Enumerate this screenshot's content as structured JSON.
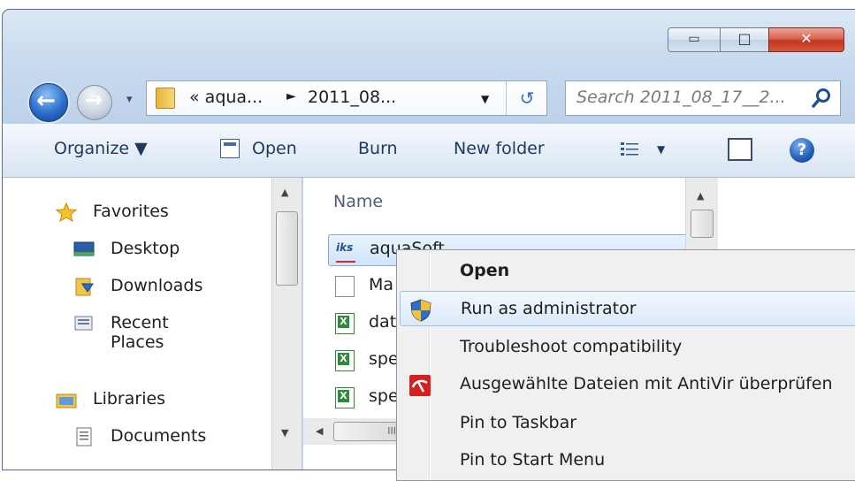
{
  "window": {
    "caption": {
      "minimize_glyph": "▭",
      "maximize_glyph": "□",
      "close_glyph": "✕"
    }
  },
  "nav": {
    "back_glyph": "←",
    "forward_glyph": "→",
    "recent_glyph": "▾"
  },
  "address": {
    "crumb_prefix": "«",
    "crumb_1": "aqua...",
    "separator": "►",
    "crumb_2": "2011_08...",
    "dropdown_glyph": "▼",
    "refresh_glyph": "↺"
  },
  "search": {
    "placeholder": "Search 2011_08_17__2..."
  },
  "toolbar": {
    "organize": "Organize ▼",
    "open": "Open",
    "burn": "Burn",
    "new_folder": "New folder",
    "views_dropdown": "▼",
    "help_glyph": "?"
  },
  "nav_pane": {
    "favorites": "Favorites",
    "desktop": "Desktop",
    "downloads": "Downloads",
    "recent_places": "Recent Places",
    "libraries": "Libraries",
    "documents": "Documents"
  },
  "content": {
    "column_name": "Name",
    "files": [
      {
        "label": "aquaSoft",
        "icon": "iks-app-icon"
      },
      {
        "label": "Ma",
        "icon": "document-icon"
      },
      {
        "label": "dat",
        "icon": "excel-icon"
      },
      {
        "label": "spe",
        "icon": "excel-icon"
      },
      {
        "label": "spe",
        "icon": "excel-icon"
      }
    ],
    "hscroll_grip": "III"
  },
  "context_menu": {
    "items": [
      {
        "label": "Open"
      },
      {
        "label": "Run as administrator"
      },
      {
        "label": "Troubleshoot compatibility"
      },
      {
        "label": "Ausgewählte Dateien mit AntiVir überprüfen"
      },
      {
        "label": "Pin to Taskbar"
      },
      {
        "label": "Pin to Start Menu"
      }
    ]
  },
  "colors": {
    "accent": "#1f5db8",
    "selection": "#cfe4fb",
    "antivir_red": "#d42020"
  }
}
